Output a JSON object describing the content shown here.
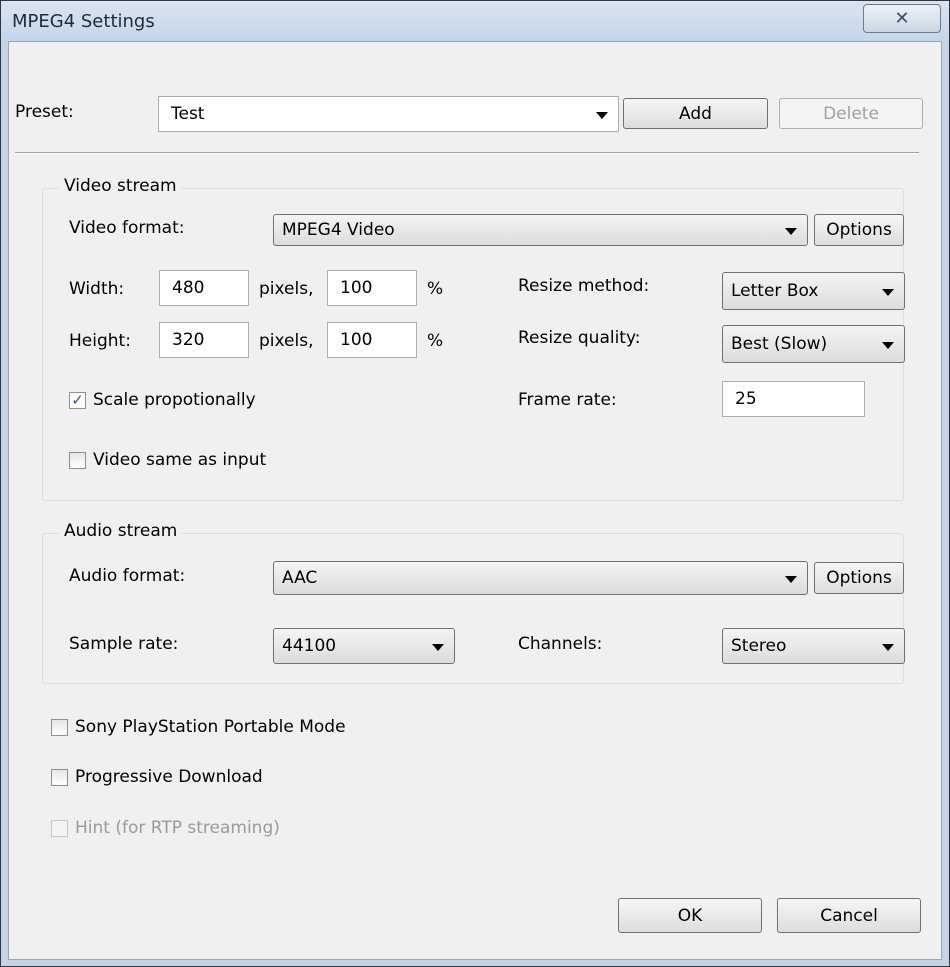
{
  "window": {
    "title": "MPEG4 Settings",
    "close_glyph": "✕"
  },
  "preset": {
    "label": "Preset:",
    "value": "Test",
    "add_label": "Add",
    "delete_label": "Delete"
  },
  "video": {
    "group_title": "Video stream",
    "format_label": "Video format:",
    "format_value": "MPEG4 Video",
    "options_label": "Options",
    "width_label": "Width:",
    "width_value": "480",
    "width_unit": "pixels,",
    "width_percent": "100",
    "height_label": "Height:",
    "height_value": "320",
    "height_unit": "pixels,",
    "height_percent": "100",
    "percent_sign": "%",
    "resize_method_label": "Resize method:",
    "resize_method_value": "Letter Box",
    "resize_quality_label": "Resize quality:",
    "resize_quality_value": "Best (Slow)",
    "frame_rate_label": "Frame rate:",
    "frame_rate_value": "25",
    "scale_label": "Scale propotionally",
    "scale_checked": true,
    "same_as_input_label": "Video same as input",
    "same_as_input_checked": false
  },
  "audio": {
    "group_title": "Audio stream",
    "format_label": "Audio format:",
    "format_value": "AAC",
    "options_label": "Options",
    "sample_rate_label": "Sample rate:",
    "sample_rate_value": "44100",
    "channels_label": "Channels:",
    "channels_value": "Stereo"
  },
  "options": {
    "psp_label": "Sony PlayStation Portable Mode",
    "progressive_label": "Progressive Download",
    "hint_label": "Hint (for RTP streaming)"
  },
  "footer": {
    "ok_label": "OK",
    "cancel_label": "Cancel"
  }
}
